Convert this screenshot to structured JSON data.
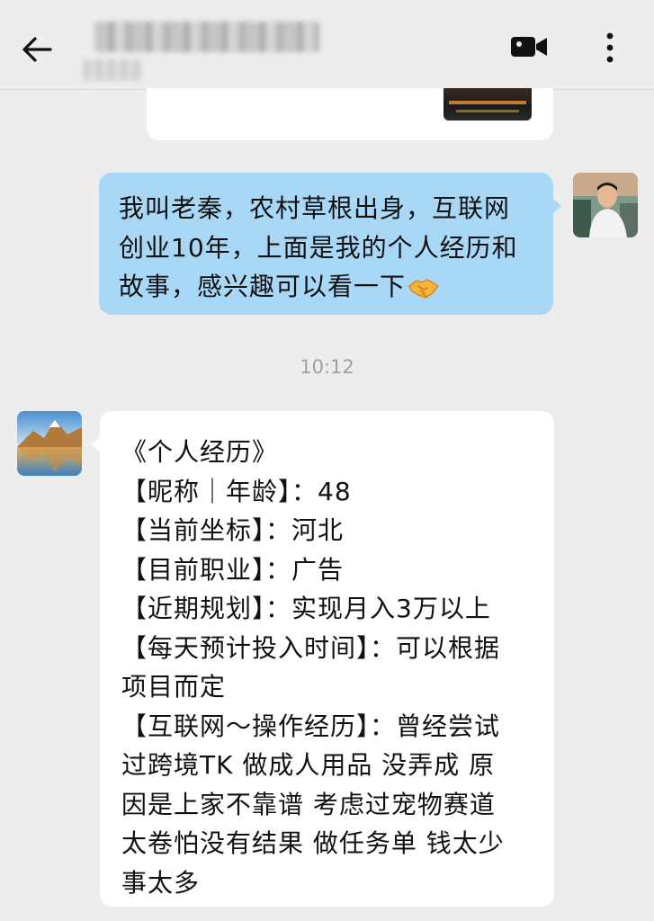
{
  "header": {
    "contact_name": "",
    "contact_subtitle": "",
    "icons": {
      "back": "back-arrow-icon",
      "video_call": "video-call-icon",
      "more": "more-vertical-icon"
    }
  },
  "messages": [
    {
      "sender": "me",
      "lines": [
        "我叫老秦，农村草根出身，互联网",
        "创业10年，上面是我的个人经历和",
        "故事，感兴趣可以看一下"
      ],
      "emoji": "handshake-emoji",
      "bubble_color": "#a9d8f7"
    },
    {
      "type": "timestamp",
      "text": "10:12"
    },
    {
      "sender": "other",
      "lines": [
        "《个人经历》",
        "【昵称｜年龄】：48",
        "【当前坐标】：河北",
        "【目前职业】：广告",
        "【近期规划】：实现月入3万以上",
        "【每天预计投入时间】：可以根据",
        "项目而定",
        "【互联网～操作经历】：曾经尝试",
        "过跨境TK 做成人用品  没弄成  原",
        "因是上家不靠谱  考虑过宠物赛道",
        "太卷怕没有结果  做任务单 钱太少",
        "事太多"
      ],
      "bubble_color": "#ffffff"
    }
  ],
  "colors": {
    "background": "#ededed",
    "my_bubble": "#a9d8f7",
    "other_bubble": "#ffffff",
    "timestamp": "#a0a0a0"
  }
}
